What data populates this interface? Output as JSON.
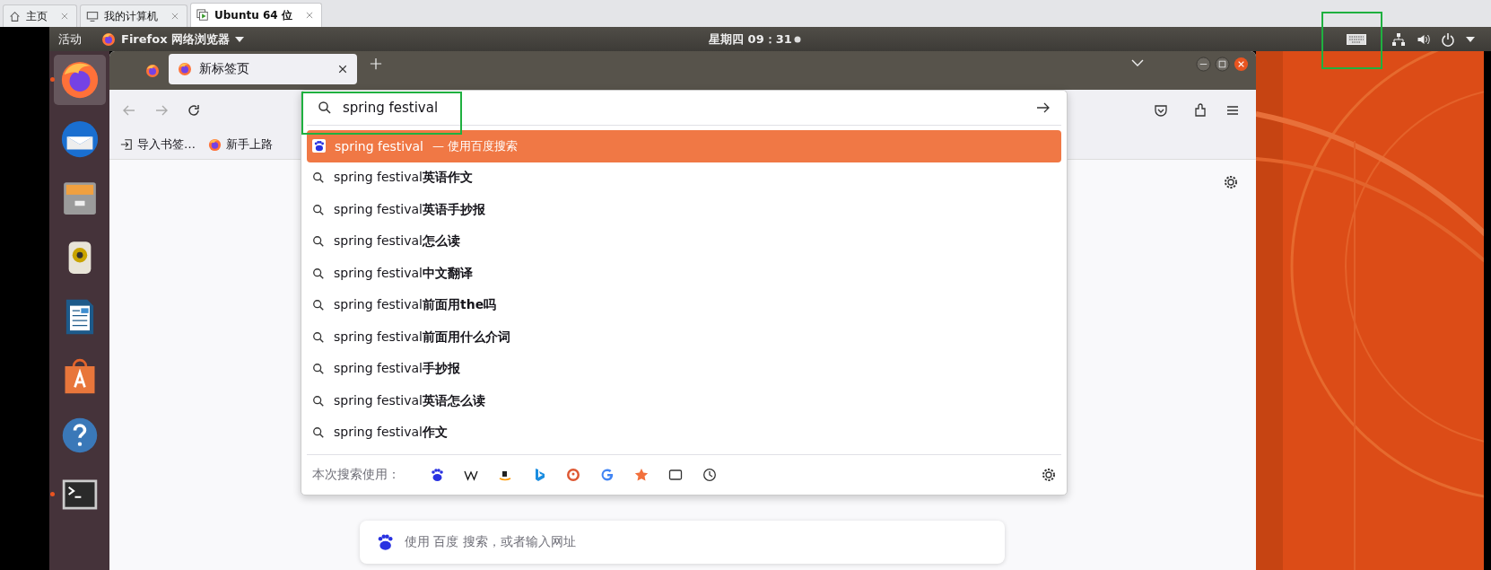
{
  "vm_tabs": [
    {
      "label": "主页",
      "kind": "home",
      "selected": false
    },
    {
      "label": "我的计算机",
      "kind": "computer",
      "selected": false
    },
    {
      "label": "Ubuntu 64 位",
      "kind": "vm",
      "selected": true
    }
  ],
  "top_bar": {
    "activities": "活动",
    "app_menu": "Firefox 网络浏览器",
    "clock": "星期四 09：31"
  },
  "dock": [
    {
      "kind": "firefox",
      "selected": true,
      "running": true
    },
    {
      "kind": "mail",
      "selected": false,
      "running": false
    },
    {
      "kind": "files",
      "selected": false,
      "running": false
    },
    {
      "kind": "music",
      "selected": false,
      "running": false
    },
    {
      "kind": "writer",
      "selected": false,
      "running": false
    },
    {
      "kind": "store",
      "selected": false,
      "running": false
    },
    {
      "kind": "help",
      "selected": false,
      "running": false
    },
    {
      "kind": "terminal",
      "selected": false,
      "running": true
    }
  ],
  "browser": {
    "tabs": [
      {
        "label": "新标签页",
        "selected": true
      }
    ],
    "urlbar": {
      "value": "spring festival"
    },
    "bookmarks": [
      "导入书签…",
      "新手上路"
    ],
    "suggestions": [
      {
        "kind": "engine",
        "text": "spring festival",
        "hint": "— 使用百度搜索",
        "selected": true
      },
      {
        "kind": "search",
        "text": "spring festival**英语作文**",
        "selected": false
      },
      {
        "kind": "search",
        "text": "spring festival**英语手抄报**",
        "selected": false
      },
      {
        "kind": "search",
        "text": "spring festival**怎么读**",
        "selected": false
      },
      {
        "kind": "search",
        "text": "spring festival**中文翻译**",
        "selected": false
      },
      {
        "kind": "search",
        "text": "spring festival**前面用the吗**",
        "selected": false
      },
      {
        "kind": "search",
        "text": "spring festival**前面用什么介词**",
        "selected": false
      },
      {
        "kind": "search",
        "text": "spring festival**手抄报**",
        "selected": false
      },
      {
        "kind": "search",
        "text": "spring festival**英语怎么读**",
        "selected": false
      },
      {
        "kind": "search",
        "text": "spring festival**作文**",
        "selected": false
      }
    ]
  },
  "search_with": {
    "label": "本次搜索使用：",
    "engines": [
      {
        "kind": "baidu"
      },
      {
        "kind": "wikipedia"
      },
      {
        "kind": "amazon"
      },
      {
        "kind": "bing"
      },
      {
        "kind": "duckduckgo"
      },
      {
        "kind": "google"
      },
      {
        "kind": "bookmarks"
      },
      {
        "kind": "tabs"
      },
      {
        "kind": "history"
      }
    ]
  },
  "newtab_search": {
    "placeholder": "使用 百度 搜索，或者输入网址"
  }
}
